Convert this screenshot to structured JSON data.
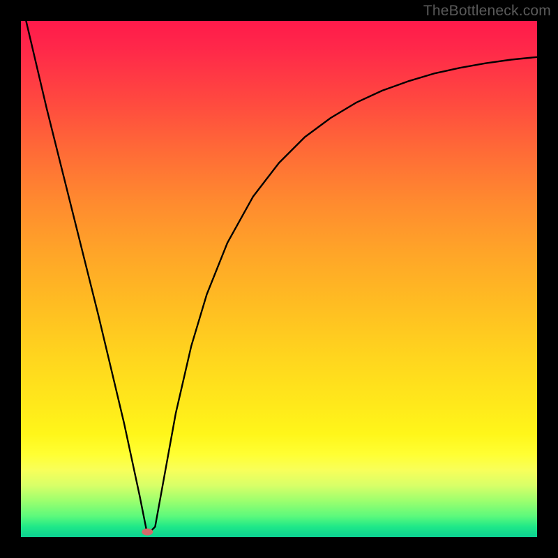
{
  "attribution": "TheBottleneck.com",
  "chart_data": {
    "type": "line",
    "title": "",
    "xlabel": "",
    "ylabel": "",
    "xlim": [
      0,
      100
    ],
    "ylim": [
      0,
      100
    ],
    "grid": false,
    "legend": false,
    "series": [
      {
        "name": "curve",
        "color": "#000000",
        "x": [
          1,
          5,
          10,
          15,
          20,
          23,
          24.5,
          26,
          28,
          30,
          33,
          36,
          40,
          45,
          50,
          55,
          60,
          65,
          70,
          75,
          80,
          85,
          90,
          95,
          100
        ],
        "y": [
          100,
          83,
          63,
          43,
          22,
          8,
          0.5,
          2,
          13,
          24,
          37,
          47,
          57,
          66,
          72.5,
          77.5,
          81.2,
          84.2,
          86.5,
          88.3,
          89.8,
          90.9,
          91.8,
          92.5,
          93
        ]
      }
    ],
    "markers": [
      {
        "name": "min-marker",
        "x": 24.5,
        "y": 1.0,
        "color": "#d46a6a"
      }
    ],
    "background_gradient": {
      "direction": "vertical",
      "stops": [
        {
          "pos": 0.0,
          "color": "#ff1a4b"
        },
        {
          "pos": 0.3,
          "color": "#ff7a33"
        },
        {
          "pos": 0.6,
          "color": "#ffd020"
        },
        {
          "pos": 0.85,
          "color": "#ffff33"
        },
        {
          "pos": 1.0,
          "color": "#0bd192"
        }
      ]
    }
  }
}
